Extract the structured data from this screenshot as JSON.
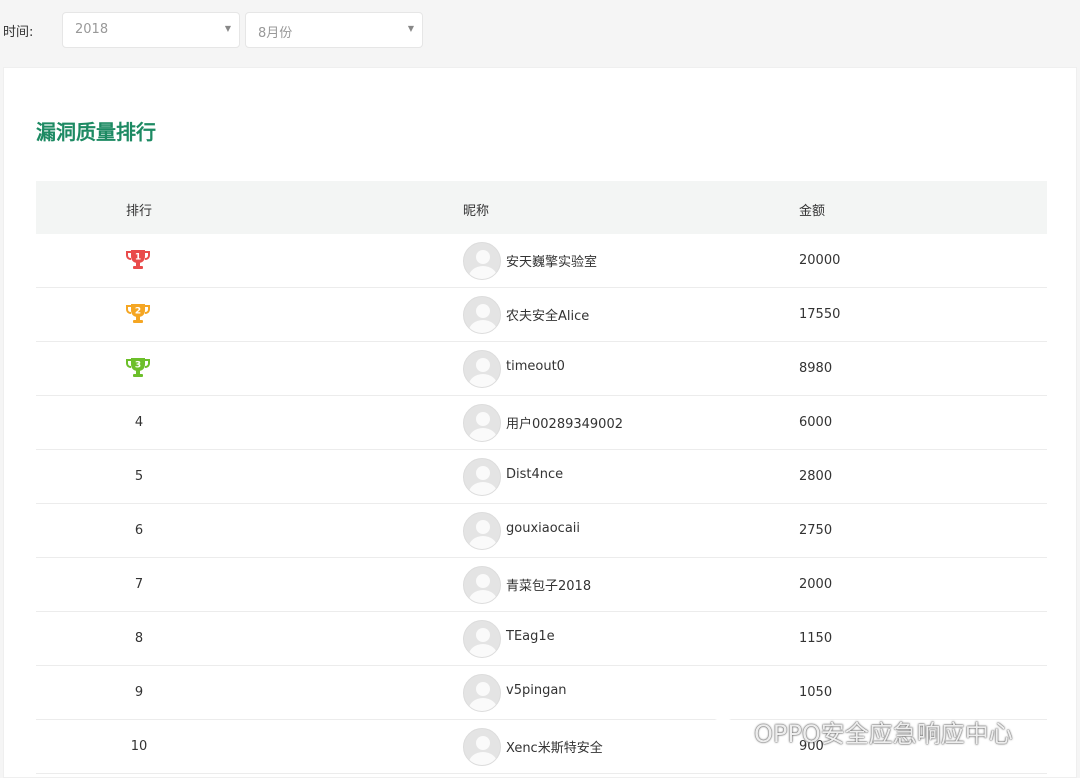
{
  "filter": {
    "label": "时间:",
    "year": "2018",
    "month": "8月份"
  },
  "title": "漏洞质量排行",
  "columns": {
    "rank": "排行",
    "nickname": "昵称",
    "amount": "金额"
  },
  "colors": {
    "title": "#1d8a63",
    "trophy_1": "#e94b4b",
    "trophy_2": "#f5a623",
    "trophy_3": "#6cbf2a"
  },
  "rows": [
    {
      "rank": "1",
      "trophy": true,
      "nickname": "安天巍擎实验室",
      "amount": "20000"
    },
    {
      "rank": "2",
      "trophy": true,
      "nickname": "农夫安全Alice",
      "amount": "17550"
    },
    {
      "rank": "3",
      "trophy": true,
      "nickname": "timeout0",
      "amount": "8980"
    },
    {
      "rank": "4",
      "nickname": "用户00289349002",
      "amount": "6000"
    },
    {
      "rank": "5",
      "nickname": "Dist4nce",
      "amount": "2800"
    },
    {
      "rank": "6",
      "nickname": "gouxiaocaii",
      "amount": "2750"
    },
    {
      "rank": "7",
      "nickname": "青菜包子2018",
      "amount": "2000"
    },
    {
      "rank": "8",
      "nickname": "TEag1e",
      "amount": "1150"
    },
    {
      "rank": "9",
      "nickname": "v5pingan",
      "amount": "1050"
    },
    {
      "rank": "10",
      "nickname": "Xenc米斯特安全",
      "amount": "900"
    }
  ],
  "watermark": "OPPO安全应急响应中心"
}
